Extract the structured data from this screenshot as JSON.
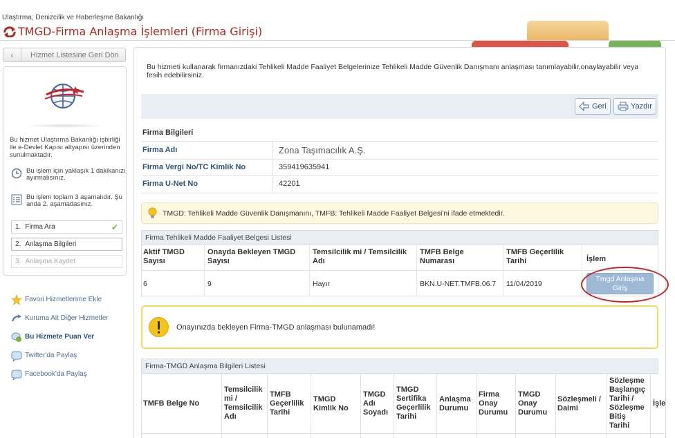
{
  "header": {
    "ministry": "Ulaştırma, Denizcilik ve Haberleşme Bakanlığı",
    "title": "TMGD-Firma Anlaşma İşlemleri (Firma Girişi)"
  },
  "sidebar": {
    "back_label": "Hizmet Listesine Geri Dön",
    "description": "Bu hizmet Ulaştırma Bakanlığı işbirliği ile e-Devlet Kapısı altyapısı üzerinden sunulmaktadır.",
    "time_info": "Bu işlem için yaklaşık 1 dakikanızı ayırmalısınız.",
    "steps_info": "Bu işlem toplam 3 aşamalıdır. Şu anda 2. aşamadasınız.",
    "steps": [
      {
        "num": "1.",
        "label": "Firma Ara",
        "state": "done"
      },
      {
        "num": "2.",
        "label": "Anlaşma Bilgileri",
        "state": "active"
      },
      {
        "num": "3.",
        "label": "Anlaşma Kaydet",
        "state": "disabled"
      }
    ],
    "links": [
      {
        "label": "Favori Hizmetlerime Ekle",
        "icon": "star-icon"
      },
      {
        "label": "Kuruma Ait Diğer Hizmetler",
        "icon": "arrow-icon"
      },
      {
        "label": "Bu Hizmete Puan Ver",
        "icon": "rate-icon"
      },
      {
        "label": "Twitter'da Paylaş",
        "icon": "twitter-icon"
      },
      {
        "label": "Facebook'da Paylaş",
        "icon": "facebook-icon"
      }
    ]
  },
  "main": {
    "description": "Bu hizmeti kullanarak firmanızdaki Tehlikeli Madde Faaliyet Belgelerinize Tehlikeli Madde Güvenlik Danışmanı anlaşması tanımlayabilir,onaylayabilir veya fesih edebilirsiniz.",
    "toolbar": {
      "back": "Geri",
      "print": "Yazdır"
    },
    "firma": {
      "heading": "Firma Bilgileri",
      "rows": [
        {
          "key": "Firma Adı",
          "value": "Zona Taşımacılık A.Ş."
        },
        {
          "key": "Firma Vergi No/TC Kimlik No",
          "value": "359419635941"
        },
        {
          "key": "Firma U-Net No",
          "value": "42201"
        }
      ]
    },
    "note": "TMGD: Tehlikeli Madde Güvenlik Danışmanını, TMFB: Tehlikeli Madde Faaliyet Belgesi'ni ifade etmektedir.",
    "tmfb_list": {
      "title": "Firma Tehlikeli Madde Faaliyet Belgesi Listesi",
      "headers": [
        [
          "Aktif TMGD",
          "Sayısı"
        ],
        [
          "Onayda Bekleyen TMGD",
          "Sayısı"
        ],
        [
          "Temsilcilik mi / Temsilcilik",
          "Adı"
        ],
        [
          "TMFB Belge",
          "Numarası"
        ],
        [
          "TMFB Geçerlilik",
          "Tarihi"
        ],
        [
          "İşlem"
        ]
      ],
      "row": [
        "6",
        "9",
        "Hayır",
        "BKN.U-NET.TMFB.06.7",
        "11/04/2019"
      ],
      "action": [
        "Tmgd Anlaşma",
        "Giriş"
      ]
    },
    "warning": "Onayınızda bekleyen Firma-TMGD anlaşması bulunamadı!",
    "agreement_list": {
      "title": "Firma-TMGD Anlaşma Bilgileri Listesi",
      "headers": [
        [
          "TMFB Belge No"
        ],
        [
          "Temsilcilik",
          "mi /",
          "Temsilcilik",
          "Adı"
        ],
        [
          "TMFB",
          "Geçerlilik",
          "Tarihi"
        ],
        [
          "TMGD",
          "Kimlik No"
        ],
        [
          "TMGD",
          "Adı",
          "Soyadı"
        ],
        [
          "TMGD",
          "Sertifika",
          "Geçerlilik",
          "Tarihi"
        ],
        [
          "Anlaşma",
          "Durumu"
        ],
        [
          "Firma",
          "Onay",
          "Durumu"
        ],
        [
          "TMGD",
          "Onay",
          "Durumu"
        ],
        [
          "Sözleşmeli /",
          "Daimi"
        ],
        [
          "Sözleşme",
          "Başlangıç",
          "Tarihi /",
          "Sözleşme",
          "Bitiş",
          "Tarihi"
        ],
        [
          "İşle"
        ]
      ]
    }
  },
  "colors": {
    "brand_red": "#b3261e",
    "link_blue": "#2c5178",
    "highlight": "#c5262c"
  }
}
